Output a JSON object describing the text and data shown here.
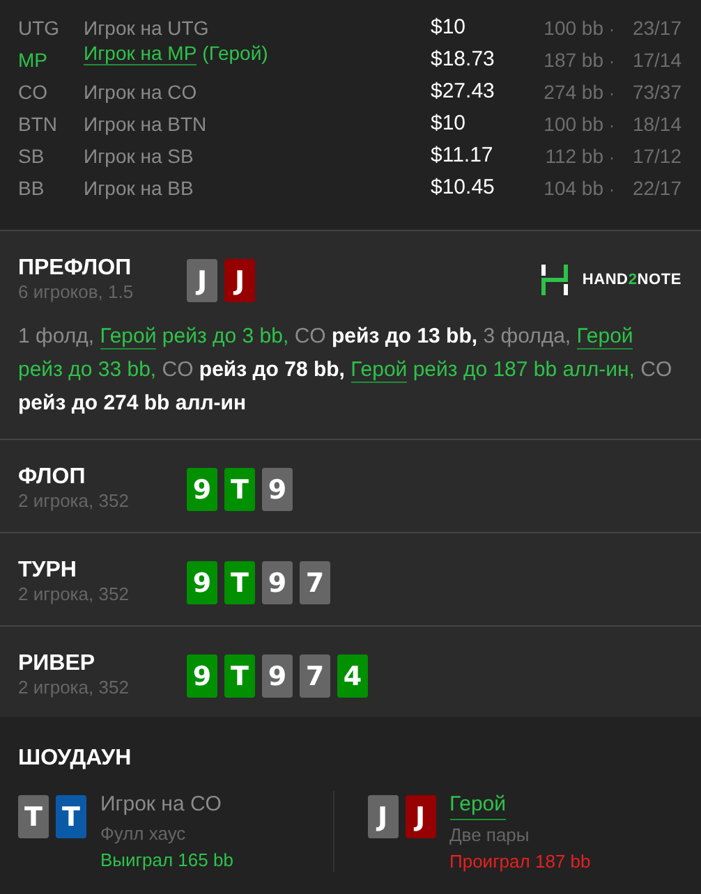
{
  "players": [
    {
      "position": "UTG",
      "name": "Игрок на UTG",
      "hero": false,
      "stack": "$10",
      "bb": "100 bb",
      "dot": "·",
      "stats": "23/17"
    },
    {
      "position": "MP",
      "name": "Игрок на MP",
      "hero": true,
      "hero_tag": "(Герой)",
      "stack": "$18.73",
      "bb": "187 bb",
      "dot": "·",
      "stats": "17/14"
    },
    {
      "position": "CO",
      "name": "Игрок на CO",
      "hero": false,
      "stack": "$27.43",
      "bb": "274 bb",
      "dot": "·",
      "stats": "73/37"
    },
    {
      "position": "BTN",
      "name": "Игрок на BTN",
      "hero": false,
      "stack": "$10",
      "bb": "100 bb",
      "dot": "·",
      "stats": "18/14"
    },
    {
      "position": "SB",
      "name": "Игрок на SB",
      "hero": false,
      "stack": "$11.17",
      "bb": "112 bb",
      "dot": "·",
      "stats": "17/12"
    },
    {
      "position": "BB",
      "name": "Игрок на BB",
      "hero": false,
      "stack": "$10.45",
      "bb": "104 bb",
      "dot": "·",
      "stats": "22/17"
    }
  ],
  "preflop": {
    "title": "ПРЕФЛОП",
    "subtitle": "6 игроков, 1.5",
    "cards": [
      {
        "rank": "J",
        "color": "#666666"
      },
      {
        "rank": "J",
        "color": "#960000"
      }
    ],
    "logo": [
      "HAND",
      "2",
      "NOTE"
    ],
    "actions": [
      {
        "kind": "muted",
        "text": "1 фолд, "
      },
      {
        "kind": "hero-link",
        "text": "Герой"
      },
      {
        "kind": "hero",
        "text": " рейз до 3 bb, "
      },
      {
        "kind": "muted",
        "text": "CO "
      },
      {
        "kind": "bold",
        "text": "рейз до 13 bb, "
      },
      {
        "kind": "muted",
        "text": "3 фолда, "
      },
      {
        "kind": "hero-link",
        "text": "Герой"
      },
      {
        "kind": "hero",
        "text": " рейз до 33 bb, "
      },
      {
        "kind": "muted",
        "text": "CO "
      },
      {
        "kind": "bold",
        "text": "рейз до 78 bb, "
      },
      {
        "kind": "hero-link",
        "text": "Герой"
      },
      {
        "kind": "hero",
        "text": " рейз до 187 bb алл-ин, "
      },
      {
        "kind": "muted",
        "text": "CO "
      },
      {
        "kind": "bold",
        "text": "рейз до 274 bb алл-ин"
      }
    ]
  },
  "streets": [
    {
      "title": "ФЛОП",
      "subtitle": "2 игрока, 352",
      "cards": [
        {
          "rank": "9",
          "color": "#009000"
        },
        {
          "rank": "T",
          "color": "#009000"
        },
        {
          "rank": "9",
          "color": "#666666"
        }
      ]
    },
    {
      "title": "ТУРН",
      "subtitle": "2 игрока, 352",
      "cards": [
        {
          "rank": "9",
          "color": "#009000"
        },
        {
          "rank": "T",
          "color": "#009000"
        },
        {
          "rank": "9",
          "color": "#666666"
        },
        {
          "rank": "7",
          "color": "#666666"
        }
      ]
    },
    {
      "title": "РИВЕР",
      "subtitle": "2 игрока, 352",
      "cards": [
        {
          "rank": "9",
          "color": "#009000"
        },
        {
          "rank": "T",
          "color": "#009000"
        },
        {
          "rank": "9",
          "color": "#666666"
        },
        {
          "rank": "7",
          "color": "#666666"
        },
        {
          "rank": "4",
          "color": "#009000"
        }
      ]
    }
  ],
  "showdown": {
    "title": "ШОУДАУН",
    "hands": [
      {
        "player": "Игрок на CO",
        "hero": false,
        "cards": [
          {
            "rank": "T",
            "color": "#666666"
          },
          {
            "rank": "T",
            "color": "#0b5aa8"
          }
        ],
        "combo": "Фулл хаус",
        "result": "Выиграл 165 bb",
        "won": true
      },
      {
        "player": "Герой",
        "hero": true,
        "cards": [
          {
            "rank": "J",
            "color": "#666666"
          },
          {
            "rank": "J",
            "color": "#960000"
          }
        ],
        "combo": "Две пары",
        "result": "Проиграл 187 bb",
        "won": false
      }
    ]
  }
}
